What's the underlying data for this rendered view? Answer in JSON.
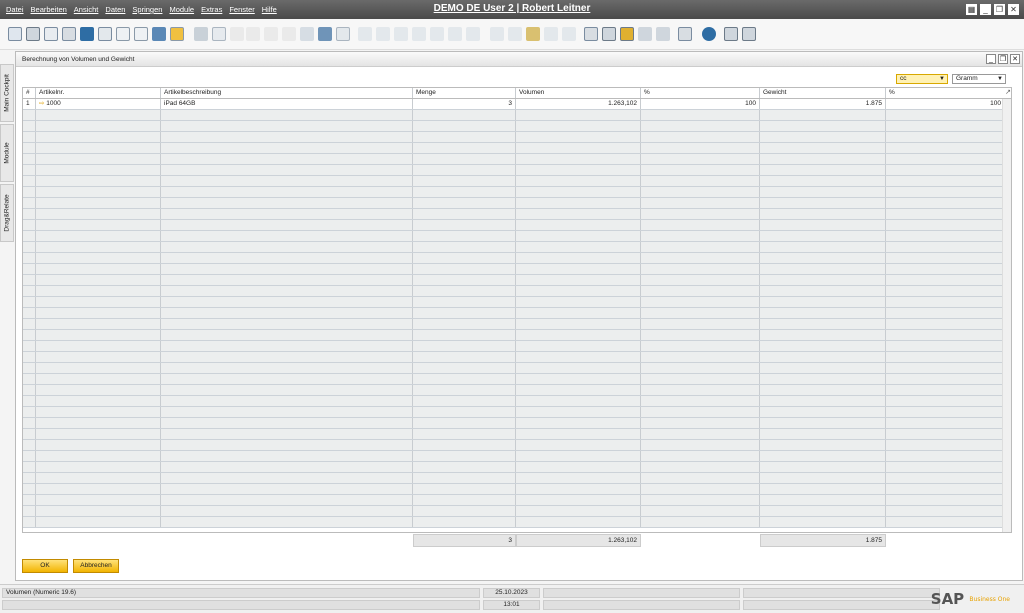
{
  "menubar": {
    "items": [
      "Datei",
      "Bearbeiten",
      "Ansicht",
      "Daten",
      "Springen",
      "Module",
      "Extras",
      "Fenster",
      "Hilfe"
    ],
    "title": "DEMO DE User 2 | Robert Leitner"
  },
  "sidebar": {
    "tabs": [
      "Main Cockpit",
      "Module",
      "Drag&Relate"
    ]
  },
  "form": {
    "title": "Berechnung von Volumen und Gewicht",
    "volume_unit": "cc",
    "weight_unit": "Gramm",
    "columns": [
      "#",
      "Artikelnr.",
      "Artikelbeschreibung",
      "Menge",
      "Volumen",
      "%",
      "Gewicht",
      "%"
    ],
    "rows": [
      {
        "no": "1",
        "item": "1000",
        "desc": "iPad 64GB",
        "qty": "3",
        "vol": "1.263,102",
        "vol_pct": "100",
        "weight": "1.875",
        "weight_pct": "100"
      }
    ],
    "totals": {
      "qty": "3",
      "vol": "1.263,102",
      "weight": "1.875"
    },
    "ok_label": "OK",
    "cancel_label": "Abbrechen"
  },
  "status": {
    "message": "Volumen (Numeric 19.6)",
    "date": "25.10.2023",
    "time": "13:01",
    "brand": "SAP",
    "brand_sub": "Business One"
  }
}
